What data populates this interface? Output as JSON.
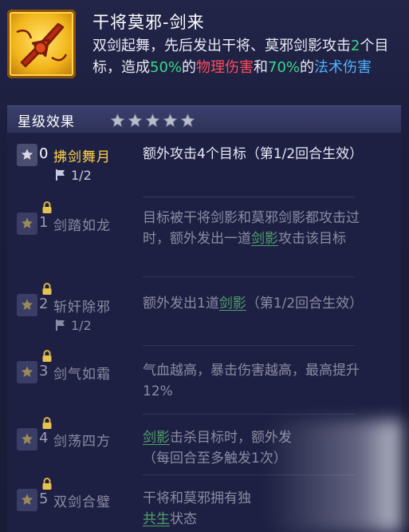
{
  "skill": {
    "icon": "crossed-swords-icon",
    "title": "干将莫邪-剑来",
    "desc": {
      "p1": "双剑起舞，先后发出干将、莫邪剑影攻击",
      "n_targets": "2",
      "p2": "个目标，造成",
      "pct1": "50%",
      "p3": "的",
      "dmg1": "物理伤害",
      "p4": "和",
      "pct2": "70%",
      "p5": "的",
      "dmg2": "法术伤害"
    }
  },
  "star_section": {
    "label": "星级效果",
    "stars": 5,
    "star_icon": "star-icon"
  },
  "effects": [
    {
      "rank": "0",
      "name": "拂剑舞月",
      "counter": "1/2",
      "locked": false,
      "active": true,
      "text": "额外攻击4个目标（第1/2回合生效）"
    },
    {
      "rank": "1",
      "name": "剑踏如龙",
      "locked": true,
      "active": false,
      "text_a": "目标被干将剑影和莫邪剑影都攻击过时，额外发出一道",
      "link": "剑影",
      "text_b": "攻击该目标"
    },
    {
      "rank": "2",
      "name": "斩奸除邪",
      "counter": "1/2",
      "locked": true,
      "active": false,
      "text_a": "额外发出1道",
      "link": "剑影",
      "text_b": "（第1/2回合生效）"
    },
    {
      "rank": "3",
      "name": "剑气如霜",
      "locked": true,
      "active": false,
      "text": "气血越高，暴击伤害越高，最高提升12%"
    },
    {
      "rank": "4",
      "name": "剑荡四方",
      "locked": true,
      "active": false,
      "link": "剑影",
      "text_b": "击杀目标时，额外发",
      "text_c": "（每回合至多触发1次）"
    },
    {
      "rank": "5",
      "name": "双剑合璧",
      "locked": true,
      "active": false,
      "text_a": "干将和莫邪拥有独",
      "link": "共生",
      "text_b": "状态"
    }
  ]
}
